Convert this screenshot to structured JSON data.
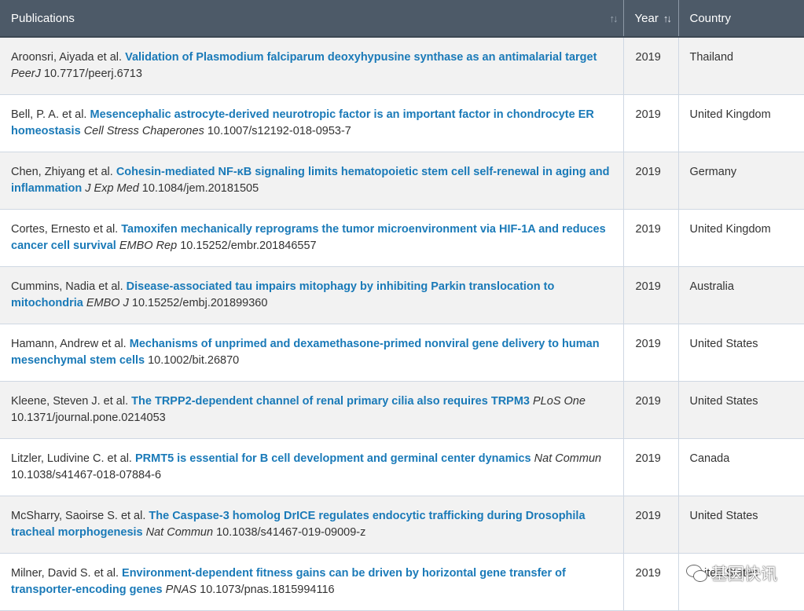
{
  "table": {
    "headers": {
      "publications": "Publications",
      "year": "Year",
      "country": "Country"
    },
    "sort_icon": "↑↓",
    "rows": [
      {
        "authors": "Aroonsri, Aiyada et al.",
        "title": "Validation of Plasmodium falciparum deoxyhypusine synthase as an antimalarial target",
        "journal": "PeerJ",
        "doi": "10.7717/peerj.6713",
        "year": "2019",
        "country": "Thailand"
      },
      {
        "authors": "Bell, P. A. et al.",
        "title": "Mesencephalic astrocyte-derived neurotropic factor is an important factor in chondrocyte ER homeostasis",
        "journal": "Cell Stress Chaperones",
        "doi": "10.1007/s12192-018-0953-7",
        "year": "2019",
        "country": "United Kingdom"
      },
      {
        "authors": "Chen, Zhiyang et al.",
        "title": "Cohesin-mediated NF-κB signaling limits hematopoietic stem cell self-renewal in aging and inflammation",
        "journal": "J Exp Med",
        "doi": "10.1084/jem.20181505",
        "year": "2019",
        "country": "Germany"
      },
      {
        "authors": "Cortes, Ernesto et al.",
        "title": "Tamoxifen mechanically reprograms the tumor microenvironment via HIF-1A and reduces cancer cell survival",
        "journal": "EMBO Rep",
        "doi": "10.15252/embr.201846557",
        "year": "2019",
        "country": "United Kingdom"
      },
      {
        "authors": "Cummins, Nadia et al.",
        "title": "Disease-associated tau impairs mitophagy by inhibiting Parkin translocation to mitochondria",
        "journal": "EMBO J",
        "doi": "10.15252/embj.201899360",
        "year": "2019",
        "country": "Australia"
      },
      {
        "authors": "Hamann, Andrew et al.",
        "title": "Mechanisms of unprimed and dexamethasone-primed nonviral gene delivery to human mesenchymal stem cells",
        "journal": "",
        "doi": "10.1002/bit.26870",
        "year": "2019",
        "country": "United States"
      },
      {
        "authors": "Kleene, Steven J. et al.",
        "title": "The TRPP2-dependent channel of renal primary cilia also requires TRPM3",
        "journal": "PLoS One",
        "doi": "10.1371/journal.pone.0214053",
        "year": "2019",
        "country": "United States"
      },
      {
        "authors": "Litzler, Ludivine C. et al.",
        "title": "PRMT5 is essential for B cell development and germinal center dynamics",
        "journal": "Nat Commun",
        "doi": "10.1038/s41467-018-07884-6",
        "year": "2019",
        "country": "Canada"
      },
      {
        "authors": "McSharry, Saoirse S. et al.",
        "title": "The Caspase-3 homolog DrICE regulates endocytic trafficking during Drosophila tracheal morphogenesis",
        "journal": "Nat Commun",
        "doi": "10.1038/s41467-019-09009-z",
        "year": "2019",
        "country": "United States"
      },
      {
        "authors": "Milner, David S. et al.",
        "title": "Environment-dependent fitness gains can be driven by horizontal gene transfer of transporter-encoding genes",
        "journal": "PNAS",
        "doi": "10.1073/pnas.1815994116",
        "year": "2019",
        "country": "United States"
      }
    ]
  },
  "watermark": {
    "icon": "wechat-icon",
    "text": "基因快讯"
  },
  "colors": {
    "header_bg": "#4d5a68",
    "link": "#1a7ab8",
    "row_alt": "#f2f2f2",
    "border": "#cfd8e3"
  }
}
